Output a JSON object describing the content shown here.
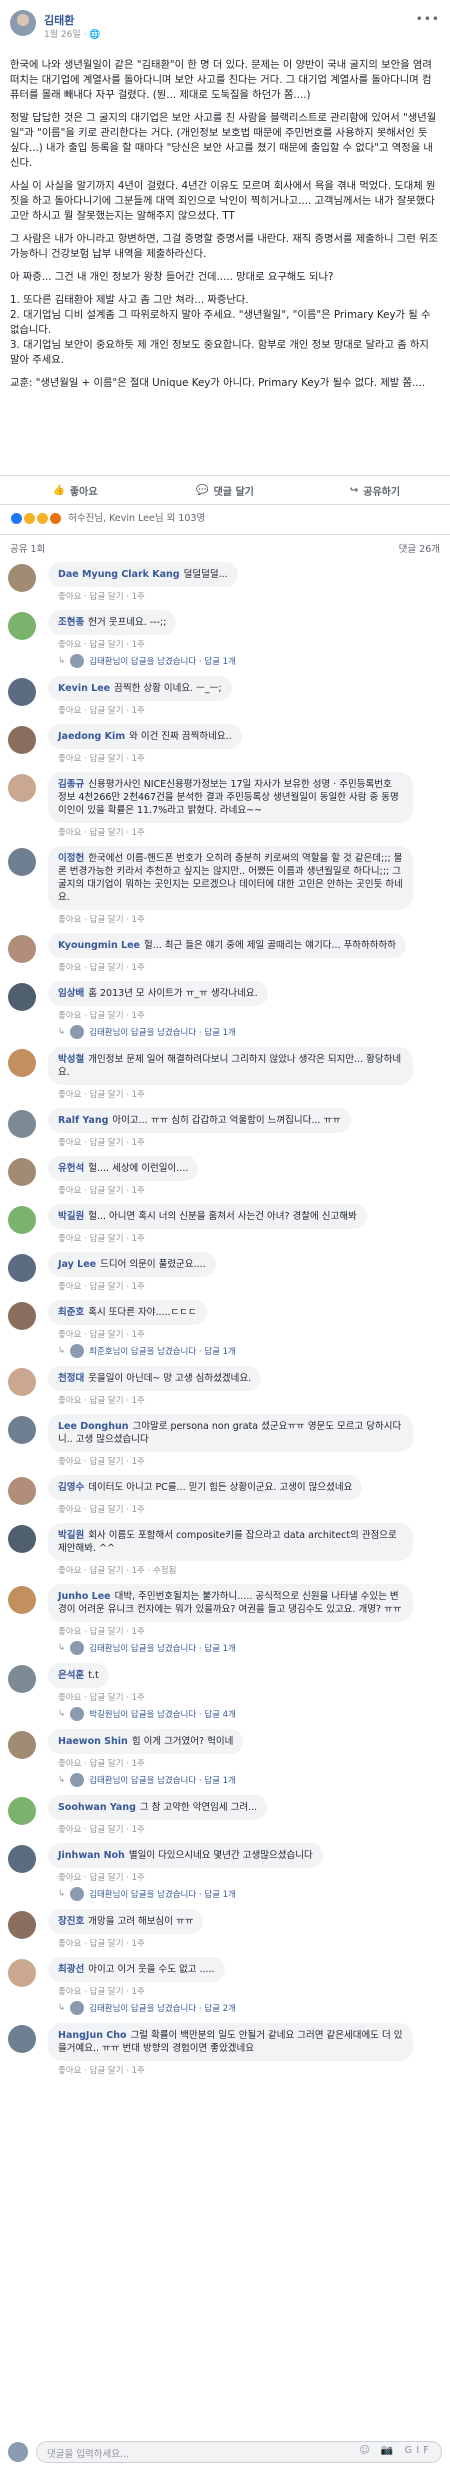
{
  "post": {
    "author": "김태환",
    "meta": "1월 26일 · 🌐",
    "paragraphs": [
      "한국에 나와 생년월일이 같은 \"김태환\"이 한 명 더 있다. 문제는 이 양반이 국내 굴지의 보안을 염려 떠치는 대기업에 계열사를 돌아다니며 보안 사고를 친다는 거다. 그 대기업 계열사를 돌아다니며 컴퓨터를 몰래 빼내다 자꾸 걸렸다. (뭔... 제대로 도둑질을 하던가 쫌....)",
      "정말 답답한 것은 그 굴지의 대기업은 보안 사고를 친 사람을 블랙리스트로 관리함에 있어서 \"생년월일\"과 \"이름\"을 키로 관리한다는 거다. (개인정보 보호법 때문에 주민번호를 사용하지 못해서인 듯 싶다...) 내가 출입 등록을 할 때마다 \"당신은 보안 사고를 쳤기 때문에 출입할 수 없다\"고 역정을 내신다.",
      "사실 이 사실을 알기까지 4년이 걸렸다. 4년간 이유도 모르며 회사에서 욕을 겪내 먹었다. 도대체 뭔짓을 하고 돌아다니기에 그분들께 대역 죄인으로 낙인이 찍히거나고.... 고객님께서는 내가 잘못했다고만 하시고 뭘 잘못했는지는 알해주지 않으셨다. TT",
      "그 사람은 내가 아니라고 항변하면, 그걸 증명할 증명서를 내란다. 재직 증명서를 제출하니 그런 위조 가능하니 건강보험 납부 내역을 제출하라신다.",
      "아 짜증... 그건 내 개인 정보가 왕창 들어간 건데..... 망대로 요구해도 되나?",
      "1. 또다른 김태환아 제발 사고 좀 그만 쳐라... 짜증난다.\n2. 대기업님 디비 설계좀 그 따위로하지 말아 주세요. \"생년월일\", \"이름\"은 Primary Key가 될 수 없습니다.\n3. 대기업님 보안이 중요하듯 제 개인 정보도 중요합니다. 함부로 개인 정보 망대로 달라고 좀 하지 말아 주세요.",
      "교훈: \"생년월일 + 이름\"은 절대 Unique Key가 아니다. Primary Key가 될수 없다. 제발 쫌...."
    ]
  },
  "actions": {
    "like": "좋아요",
    "comment": "댓글 달기",
    "share": "공유하기"
  },
  "reactions": {
    "text": "허수진님, Kevin Lee님 외 103명"
  },
  "share_row": {
    "left": "공유 1회",
    "right": "댓글 26개"
  },
  "comment_meta": {
    "like": "좋아요",
    "reply": "답글 달기",
    "time": "1주"
  },
  "comments": [
    {
      "name": "Dae Myung Clark Kang",
      "text": "덜덜덜덜...",
      "meta": "좋아요 · 답글 달기 · 1주",
      "reply": ""
    },
    {
      "name": "조현종",
      "text": "헌거 웃프네요. ---;;",
      "meta": "좋아요 · 답글 달기 · 1주",
      "reply": "김태환님이 답글을 남겼습니다 · 답글 1개"
    },
    {
      "name": "Kevin Lee",
      "text": "끔찍한 상황 이네요. ㅡ_ㅡ;",
      "meta": "좋아요 · 답글 달기 · 1주",
      "reply": ""
    },
    {
      "name": "Jaedong Kim",
      "text": "와 이건 진짜 끔찍하네요..",
      "meta": "좋아요 · 답글 달기 · 1주",
      "reply": ""
    },
    {
      "name": "김종규",
      "text": "신용평가사인 NICE신용평가정보는 17일 자사가 보유한 성명 · 주민등록번호 정보 4천266만 2천467건을 분석한 결과 주민등록상 생년월일이 동일한 사람 중 동명이인이 있을 확률은 11.7%라고 밝혔다. 라네요~~",
      "meta": "좋아요 · 답글 달기 · 1주",
      "reply": ""
    },
    {
      "name": "이정헌",
      "text": "한국에선 이름-핸드폰 번호가 오히려 충분히 키로써의 역할을 할 것 같은데;;; 물론 번경가능한 키라서 추천하고 싶지는 않지만.. 어쨌든 이름과 생년월일로 하다니;;; 그 굴지의 대기업이 뭐하는 곳인지는 모르겠으나 데이터에 대한 고민은 안하는 곳인듯 하네요.",
      "meta": "좋아요 · 답글 달기 · 1주",
      "reply": ""
    },
    {
      "name": "Kyoungmin Lee",
      "text": "헐... 최근 들은 얘기 중에 제일 골때리는 얘기다... 푸하하하하하",
      "meta": "좋아요 · 답글 달기 · 1주",
      "reply": ""
    },
    {
      "name": "임상배",
      "text": "홈 2013년 모 사이트가 ㅠ_ㅠ 생각나네요.",
      "meta": "좋아요 · 답글 달기 · 1주",
      "reply": "김태환님이 답글을 남겼습니다 · 답글 1개"
    },
    {
      "name": "박성철",
      "text": "개인정보 문제 일어 해결하려다보니 그리하지 않았나 생각은 되지만... 황당하네요.",
      "meta": "좋아요 · 답글 달기 · 1주",
      "reply": ""
    },
    {
      "name": "Ralf Yang",
      "text": "아이고... ㅠㅠ 심히 갑갑하고 억울함이 느껴집니다... ㅠㅠ",
      "meta": "좋아요 · 답글 달기 · 1주",
      "reply": ""
    },
    {
      "name": "유헌석",
      "text": "헐.... 세상에 이런일이....",
      "meta": "좋아요 · 답글 달기 · 1주",
      "reply": ""
    },
    {
      "name": "박길원",
      "text": "헐... 아니면 혹시 너의 신분을 훔쳐서 사는건 아녀? 경찰에 신고해봐",
      "meta": "좋아요 · 답글 달기 · 1주",
      "reply": ""
    },
    {
      "name": "Jay Lee",
      "text": "드디어 의문이 풀렸군요....",
      "meta": "좋아요 · 답글 달기 · 1주",
      "reply": ""
    },
    {
      "name": "최준호",
      "text": "혹시 또다른 자야.....ㄷㄷㄷ",
      "meta": "좋아요 · 답글 달기 · 1주",
      "reply": "최준호님이 답글을 남겼습니다 · 답글 1개"
    },
    {
      "name": "천정대",
      "text": "웃을일이 아닌데~ 망 고생 심하셨겠네요.",
      "meta": "좋아요 · 답글 달기 · 1주",
      "reply": ""
    },
    {
      "name": "Lee Donghun",
      "text": "그야말로 persona non grata 셨군요ㅠㅠ 영문도 모르고 당하시다니.. 고생 많으셨습니다",
      "meta": "좋아요 · 답글 달기 · 1주",
      "reply": ""
    },
    {
      "name": "김영수",
      "text": "데이터도 아니고 PC를... 믿기 힘든 상황이군요. 고생이 많으셨네요",
      "meta": "좋아요 · 답글 달기 · 1주",
      "reply": ""
    },
    {
      "name": "박길원",
      "text": "회사 이름도 포함해서 composite키를 잡으라고 data architect의 관점으로 제안해봐. ^^",
      "meta": "좋아요 · 답글 달기 · 1주 · 수정됨",
      "reply": ""
    },
    {
      "name": "Junho Lee",
      "text": "대박, 주민번호될치는 불가하니..... 공식적으로 신원을 나타낼 수있는 변경이 어려운 유니크 컨자에는 뭐가 있을까요? 여권을 들고 댕김수도 있고요. 개명? ㅠㅠ",
      "meta": "좋아요 · 답글 달기 · 1주",
      "reply": "김태환님이 답글을 남겼습니다 · 답글 1개"
    },
    {
      "name": "은석훈",
      "text": "t.t",
      "meta": "좋아요 · 답글 달기 · 1주",
      "reply": "박길원님이 답글을 남겼습니다 · 답글 4개"
    },
    {
      "name": "Haewon Shin",
      "text": "힘 이게 그거였어? 헉이네",
      "meta": "좋아요 · 답글 달기 · 1주",
      "reply": "김태환님이 답글을 남겼습니다 · 답글 1개"
    },
    {
      "name": "Soohwan Yang",
      "text": "그 참 고약한 악연임세 그려...",
      "meta": "좋아요 · 답글 달기 · 1주",
      "reply": ""
    },
    {
      "name": "Jinhwan Noh",
      "text": "별일이 다있으시네요 몇년간 고생많으셨습니다",
      "meta": "좋아요 · 답글 달기 · 1주",
      "reply": "김태환님이 답글을 남겼습니다 · 답글 1개"
    },
    {
      "name": "장진호",
      "text": "개망을 고려 해보심이 ㅠㅠ",
      "meta": "좋아요 · 답글 달기 · 1주",
      "reply": ""
    },
    {
      "name": "최광선",
      "text": "아이고 이거 웃을 수도 없고 .....",
      "meta": "좋아요 · 답글 달기 · 1주",
      "reply": "김태환님이 답글을 남겼습니다 · 답글 2개"
    },
    {
      "name": "HangJun Cho",
      "text": "그럴 확률이 백만분의 일도 안될거 같네요 그러면 같은세대에도 더 있을거예요.. ㅠㅠ 번대 방향의 경험이면 좋았겠네요",
      "meta": "좋아요 · 답글 달기 · 1주",
      "reply": ""
    }
  ],
  "input": {
    "placeholder": "댓글을 입력하세요..."
  },
  "colors": {
    "link": "#385898",
    "bubble": "#f2f3f5",
    "meta": "#90949c"
  }
}
